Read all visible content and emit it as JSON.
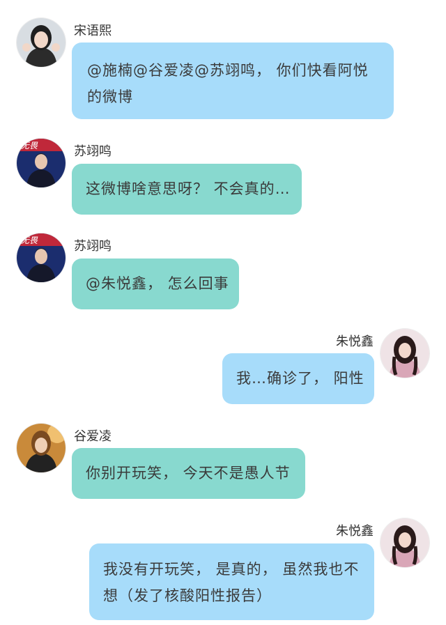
{
  "colors": {
    "bubble_blue": "#a7dcfa",
    "bubble_teal": "#88d9cf",
    "background": "#ffffff"
  },
  "messages": [
    {
      "sender": "宋语熙",
      "text": "@施楠@谷爱凌@苏翊鸣， 你们快看阿悦的微博",
      "side": "left",
      "bubble": "blue",
      "avatar_icon": "woman-avatar"
    },
    {
      "sender": "苏翊鸣",
      "text": "这微博啥意思呀？ 不会真的…",
      "side": "left",
      "bubble": "teal",
      "avatar_icon": "man-avatar"
    },
    {
      "sender": "苏翊鸣",
      "text": "@朱悦鑫， 怎么回事",
      "side": "left",
      "bubble": "teal",
      "avatar_icon": "man-avatar"
    },
    {
      "sender": "朱悦鑫",
      "text": "我…确诊了， 阳性",
      "side": "right",
      "bubble": "blue",
      "avatar_icon": "girl-avatar"
    },
    {
      "sender": "谷爱凌",
      "text": "你别开玩笑， 今天不是愚人节",
      "side": "left",
      "bubble": "teal",
      "avatar_icon": "woman-avatar"
    },
    {
      "sender": "朱悦鑫",
      "text": "我没有开玩笑， 是真的， 虽然我也不想（发了核酸阳性报告）",
      "side": "right",
      "bubble": "blue",
      "avatar_icon": "girl-avatar"
    }
  ]
}
